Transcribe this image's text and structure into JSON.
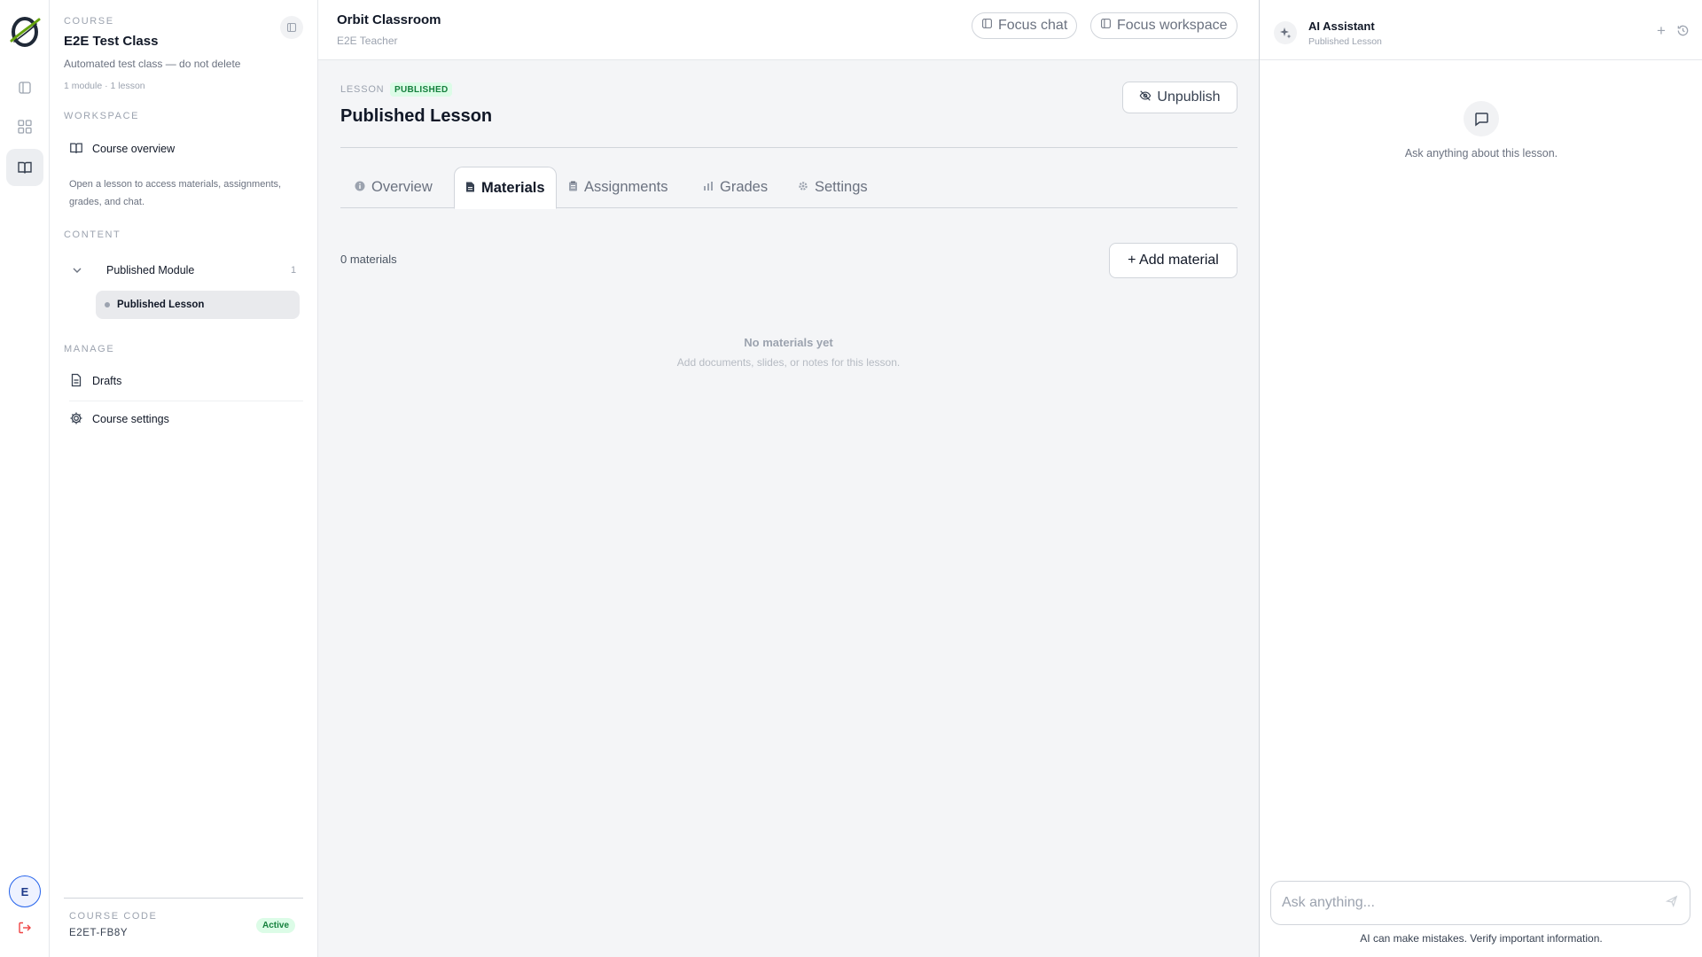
{
  "rail": {
    "avatar_initial": "E"
  },
  "sidebar": {
    "course_eyebrow": "COURSE",
    "course_title": "E2E Test Class",
    "course_description": "Automated test class — do not delete",
    "course_meta": "1 module · 1 lesson",
    "workspace_label": "WORKSPACE",
    "course_overview_label": "Course overview",
    "help_text": "Open a lesson to access materials, assignments, grades, and chat.",
    "content_label": "CONTENT",
    "module": {
      "name": "Published Module",
      "count": "1"
    },
    "lesson": {
      "name": "Published Lesson"
    },
    "manage_label": "MANAGE",
    "drafts_label": "Drafts",
    "course_settings_label": "Course settings",
    "course_code_label": "COURSE CODE",
    "course_code": "E2ET-FB8Y",
    "status_badge": "Active"
  },
  "topbar": {
    "app_title": "Orbit Classroom",
    "app_subtitle": "E2E Teacher",
    "focus_chat_label": "Focus chat",
    "focus_workspace_label": "Focus workspace"
  },
  "lesson": {
    "eyebrow": "LESSON",
    "status_badge": "PUBLISHED",
    "title": "Published Lesson",
    "unpublish_label": "Unpublish",
    "tabs": [
      {
        "label": "Overview",
        "icon": "info-icon"
      },
      {
        "label": "Materials",
        "icon": "document-icon",
        "active": true
      },
      {
        "label": "Assignments",
        "icon": "clipboard-icon"
      },
      {
        "label": "Grades",
        "icon": "bar-chart-icon"
      },
      {
        "label": "Settings",
        "icon": "gear-icon"
      }
    ],
    "materials_count": "0 materials",
    "add_material_label": "+ Add material",
    "empty_title": "No materials yet",
    "empty_subtitle": "Add documents, slides, or notes for this lesson."
  },
  "assistant": {
    "title": "AI Assistant",
    "subtitle": "Published Lesson",
    "hint": "Ask anything about this lesson.",
    "input_placeholder": "Ask anything...",
    "disclaimer": "AI can make mistakes. Verify important information."
  },
  "colors": {
    "accent_green_bg": "#dcfce7",
    "accent_green_text": "#15803d",
    "logout_red": "#ef4444",
    "avatar_ring": "#2563eb"
  }
}
